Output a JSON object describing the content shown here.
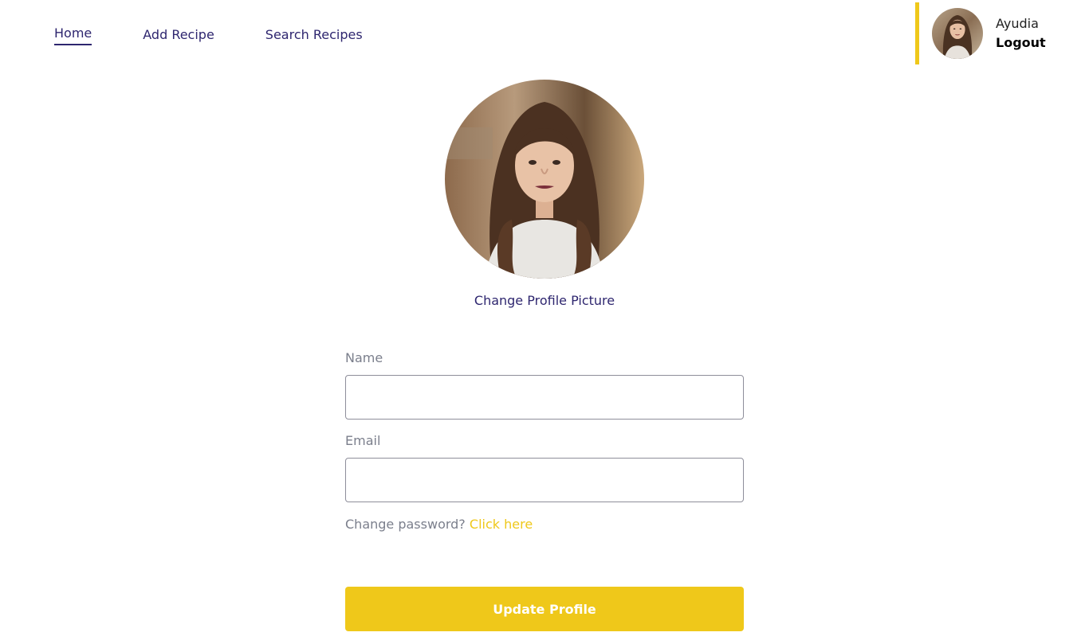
{
  "nav": {
    "items": [
      {
        "label": "Home",
        "active": true
      },
      {
        "label": "Add Recipe",
        "active": false
      },
      {
        "label": "Search Recipes",
        "active": false
      }
    ]
  },
  "user": {
    "name": "Ayudia",
    "logout_label": "Logout"
  },
  "profile": {
    "change_picture_label": "Change Profile Picture"
  },
  "form": {
    "name_label": "Name",
    "name_value": "",
    "email_label": "Email",
    "email_value": "",
    "change_password_text": "Change password?",
    "click_here_label": "Click here",
    "submit_label": "Update Profile"
  },
  "colors": {
    "accent": "#efc81a",
    "nav_text": "#2e266f",
    "label_text": "#7b7f8c"
  }
}
